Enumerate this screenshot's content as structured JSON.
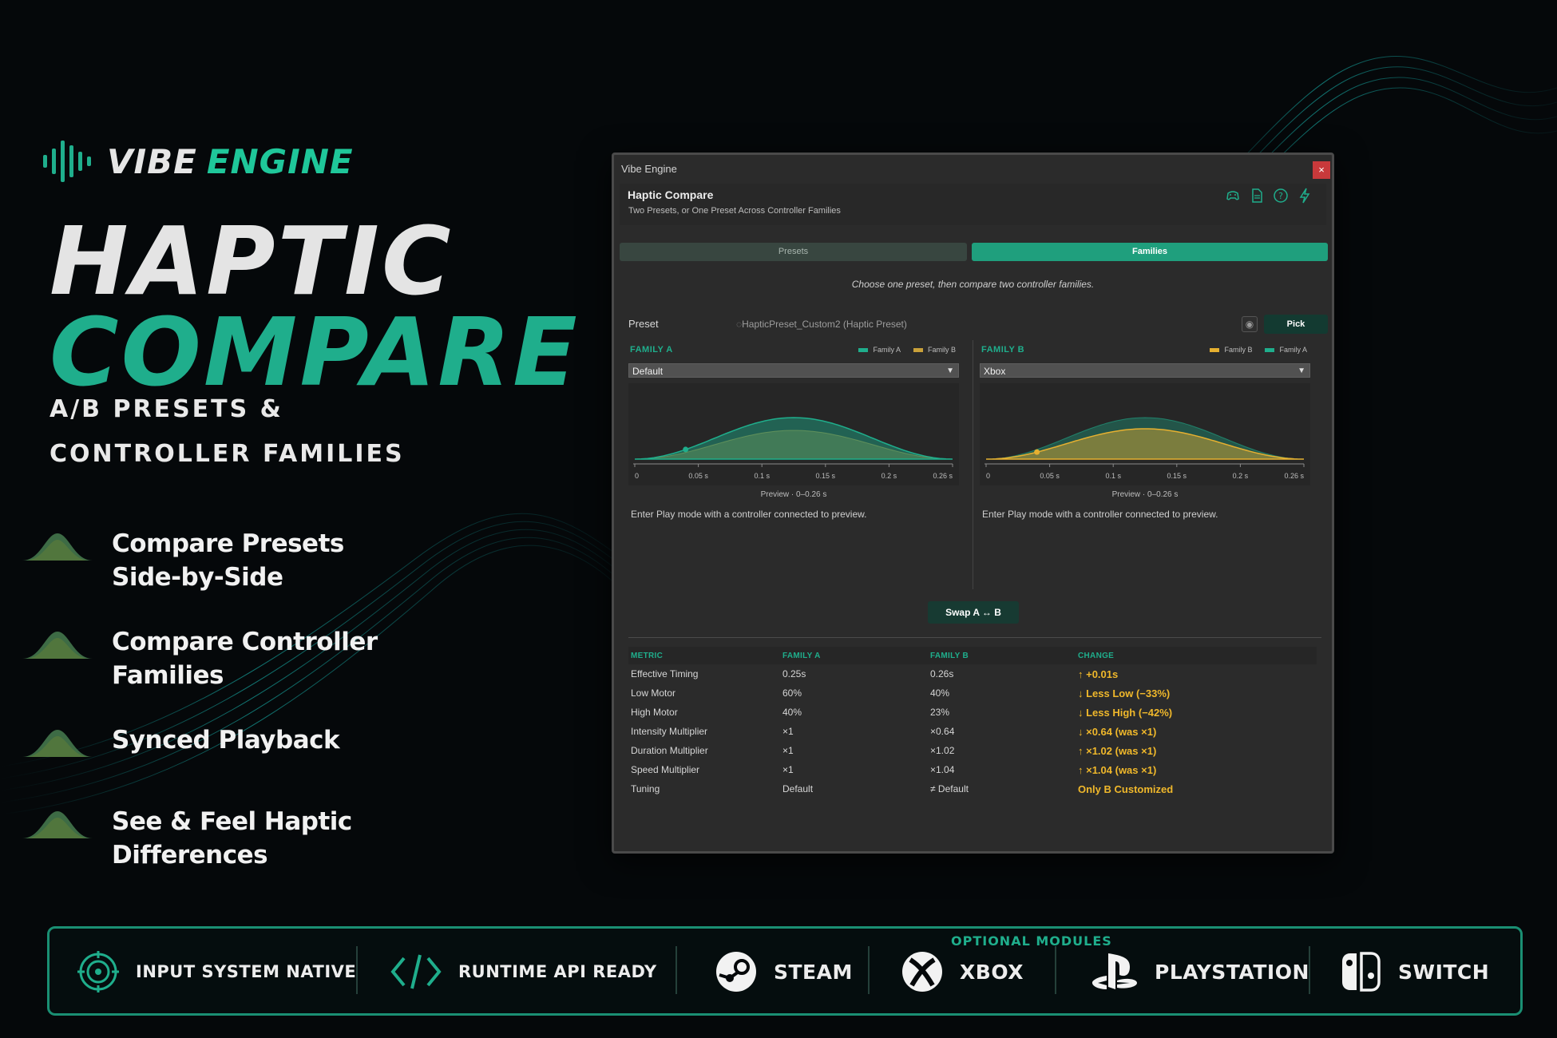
{
  "brand": {
    "word1": "VIBE",
    "word2": "ENGINE"
  },
  "hero": {
    "line1": "HAPTIC",
    "line2": "COMPARE",
    "sub1": "A/B PRESETS &",
    "sub2": "CONTROLLER FAMILIES"
  },
  "features": [
    {
      "line1": "Compare Presets",
      "line2": "Side-by-Side"
    },
    {
      "line1": "Compare Controller",
      "line2": "Families"
    },
    {
      "line1": "Synced Playback",
      "line2": ""
    },
    {
      "line1": "See & Feel Haptic",
      "line2": "Differences"
    }
  ],
  "window": {
    "title": "Vibe Engine",
    "close": "×",
    "header": {
      "title": "Haptic Compare",
      "subtitle": "Two Presets, or One Preset Across Controller Families",
      "icons": [
        "controller-icon",
        "document-icon",
        "help-icon",
        "lightning-icon"
      ]
    },
    "tabs": {
      "presets": "Presets",
      "families": "Families"
    },
    "hint": "Choose one preset, then compare two controller families.",
    "preset": {
      "label": "Preset",
      "value": "HapticPreset_Custom2 (Haptic Preset)",
      "pick": "Pick"
    },
    "family_a": {
      "label": "FAMILY A",
      "legend": [
        "Family A",
        "Family B"
      ],
      "selected": "Default",
      "caption": "Preview · 0–0.26 s",
      "message": "Enter Play mode with a controller connected to preview."
    },
    "family_b": {
      "label": "FAMILY B",
      "legend": [
        "Family B",
        "Family A"
      ],
      "selected": "Xbox",
      "caption": "Preview · 0–0.26 s",
      "message": "Enter Play mode with a controller connected to preview."
    },
    "swap": "Swap A ↔ B",
    "table": {
      "headers": [
        "METRIC",
        "FAMILY A",
        "FAMILY B",
        "CHANGE"
      ],
      "rows": [
        [
          "Effective Timing",
          "0.25s",
          "0.26s",
          "↑ +0.01s"
        ],
        [
          "Low Motor",
          "60%",
          "40%",
          "↓ Less Low (−33%)"
        ],
        [
          "High Motor",
          "40%",
          "23%",
          "↓ Less High (−42%)"
        ],
        [
          "Intensity Multiplier",
          "×1",
          "×0.64",
          "↓ ×0.64 (was ×1)"
        ],
        [
          "Duration Multiplier",
          "×1",
          "×1.02",
          "↑ ×1.02 (was ×1)"
        ],
        [
          "Speed Multiplier",
          "×1",
          "×1.04",
          "↑ ×1.04 (was ×1)"
        ],
        [
          "Tuning",
          "Default",
          "≠ Default",
          "Only B Customized"
        ]
      ]
    }
  },
  "chart_data": [
    {
      "type": "area",
      "x_ticks": [
        "0",
        "0.05 s",
        "0.1 s",
        "0.15 s",
        "0.2 s",
        "0.26 s"
      ],
      "xlim": [
        0,
        0.26
      ],
      "series": [
        {
          "name": "Family A",
          "color": "#1fae8c"
        },
        {
          "name": "Family B",
          "color": "#c9a13a"
        }
      ],
      "xlabel": "Preview · 0–0.26 s"
    },
    {
      "type": "area",
      "x_ticks": [
        "0",
        "0.05 s",
        "0.1 s",
        "0.15 s",
        "0.2 s",
        "0.26 s"
      ],
      "xlim": [
        0,
        0.26
      ],
      "series": [
        {
          "name": "Family B",
          "color": "#e6b030"
        },
        {
          "name": "Family A",
          "color": "#1fae8c"
        }
      ],
      "xlabel": "Preview · 0–0.26 s"
    }
  ],
  "bottom": {
    "optional_label": "OPTIONAL MODULES",
    "badges": [
      {
        "text": "INPUT SYSTEM NATIVE",
        "icon": "target-icon"
      },
      {
        "text": "RUNTIME API READY",
        "icon": "code-icon"
      },
      {
        "text": "STEAM",
        "icon": "steam-icon"
      },
      {
        "text": "XBOX",
        "icon": "xbox-icon"
      },
      {
        "text": "PLAYSTATION",
        "icon": "playstation-icon"
      },
      {
        "text": "SWITCH",
        "icon": "switch-icon"
      }
    ]
  },
  "colors": {
    "accent": "#1fae8c",
    "warning": "#f0b82b",
    "close": "#c8393b"
  }
}
